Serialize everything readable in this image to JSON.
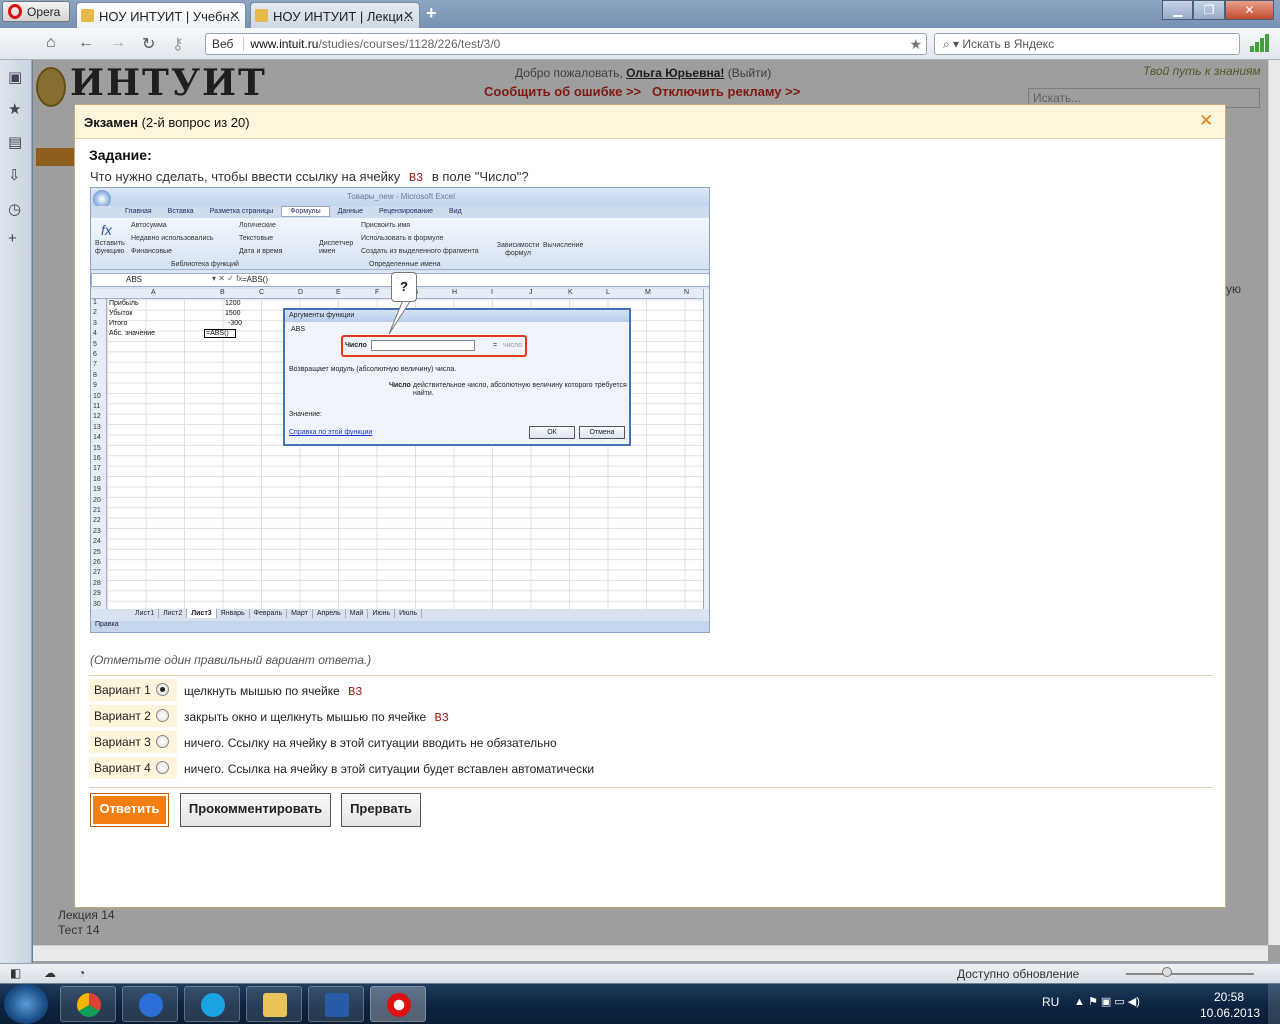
{
  "browser": {
    "menu_label": "Opera",
    "tabs": [
      {
        "label": "НОУ ИНТУИТ | Учебн..."
      },
      {
        "label": "НОУ ИНТУИТ | Лекци..."
      }
    ],
    "address": {
      "scheme_label": "Веб",
      "host": "www.intuit.ru",
      "path": "/studies/courses/1128/226/test/3/0"
    },
    "search_placeholder": "Искать в Яндекс",
    "status": {
      "update": "Доступно обновление"
    }
  },
  "site": {
    "logo": "ИНТУИТ",
    "welcome_prefix": "Добро пожаловать,",
    "user": "Ольга Юрьевна!",
    "logout": "(Выйти)",
    "report_error": "Сообщить об ошибке >>",
    "disable_ads": "Отключить рекламу >>",
    "tagline": "Твой путь к знаниям",
    "search_placeholder": "Искать...",
    "sidebar_bottom": [
      "Лекция 14",
      "Тест 14"
    ],
    "side_right": "ую"
  },
  "dialog": {
    "title_bold": "Экзамен",
    "title_rest": "(2-й вопрос из 20)",
    "task_label": "Задание:",
    "question_pre": "Что нужно сделать, чтобы ввести ссылку на ячейку",
    "question_code": "B3",
    "question_post": "в поле \"Число\"?",
    "hint": "(Отметьте один правильный вариант ответа.)",
    "options": [
      {
        "label": "Вариант 1",
        "text": "щелкнуть мышью по ячейке",
        "code": "B3",
        "selected": true
      },
      {
        "label": "Вариант 2",
        "text": "закрыть окно и щелкнуть мышью по ячейке",
        "code": "B3",
        "selected": false
      },
      {
        "label": "Вариант 3",
        "text": "ничего. Ссылку на ячейку в этой ситуации вводить не обязательно",
        "code": "",
        "selected": false
      },
      {
        "label": "Вариант 4",
        "text": "ничего. Ссылка на ячейку в этой ситуации будет вставлен автоматически",
        "code": "",
        "selected": false
      }
    ],
    "buttons": {
      "answer": "Ответить",
      "comment": "Прокомментировать",
      "abort": "Прервать"
    }
  },
  "excel": {
    "title": "Товары_new - Microsoft Excel",
    "ribbon_tabs": [
      "Главная",
      "Вставка",
      "Разметка страницы",
      "Формулы",
      "Данные",
      "Рецензирование",
      "Вид"
    ],
    "ribbon": {
      "insert_fn": "Вставить функцию",
      "autosum": "Автосумма",
      "recent": "Недавно использовались",
      "financial": "Финансовые",
      "logical": "Логические",
      "text": "Текстовые",
      "datetime": "Дата и время",
      "library": "Библиотека функций",
      "name_mgr": "Диспетчер имен",
      "assign": "Присвоить имя",
      "use_in_formula": "Использовать в формуле",
      "create_from_sel": "Создать из выделенного фрагмента",
      "defined_names": "Определенные имена",
      "dependencies": "Зависимости формул",
      "calc": "Вычисление"
    },
    "name_box": "ABS",
    "formula": "=ABS()",
    "columns": [
      "A",
      "B",
      "C",
      "D",
      "E",
      "F",
      "G",
      "H",
      "I",
      "J",
      "K",
      "L",
      "M",
      "N"
    ],
    "rows": [
      {
        "label": "Прибыль",
        "value": "1200"
      },
      {
        "label": "Убыток",
        "value": "1500"
      },
      {
        "label": "Итого",
        "value": "-300"
      },
      {
        "label": "Абс. значение",
        "value": "=ABS()"
      }
    ],
    "sheets": [
      "Лист1",
      "Лист2",
      "Лист3",
      "Январь",
      "Февраль",
      "Март",
      "Апрель",
      "Май",
      "Июнь",
      "Июль"
    ],
    "status": "Правка",
    "fn_dialog": {
      "title": "Аргументы функции",
      "fn": "ABS",
      "arg_label": "Число",
      "eq": "=",
      "arg_hint": "число",
      "desc": "Возвращает модуль (абсолютную величину) числа.",
      "arg_name": "Число",
      "arg_desc": "действительное число, абсолютную величину которого требуется найти.",
      "value_label": "Значение:",
      "help": "Справка по этой функции",
      "ok": "ОК",
      "cancel": "Отмена"
    },
    "callout": "?"
  },
  "taskbar": {
    "lang": "RU",
    "time": "20:58",
    "date": "10.06.2013"
  }
}
